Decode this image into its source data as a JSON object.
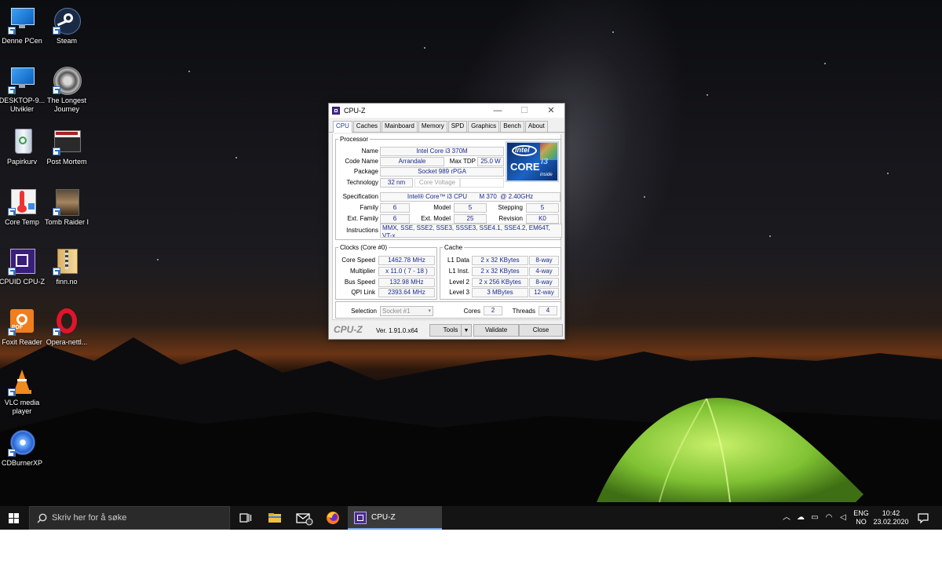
{
  "desktop": {
    "icons": [
      {
        "label": "Denne PCen"
      },
      {
        "label": "Steam"
      },
      {
        "label": "DESKTOP-9... Utvikler"
      },
      {
        "label": "The Longest Journey"
      },
      {
        "label": "Papirkurv"
      },
      {
        "label": "Post Mortem"
      },
      {
        "label": "Core Temp"
      },
      {
        "label": "Tomb Raider I"
      },
      {
        "label": "CPUID CPU-Z"
      },
      {
        "label": "finn.no"
      },
      {
        "label": "Foxit Reader"
      },
      {
        "label": "Opera-nettl..."
      },
      {
        "label": "VLC media player"
      },
      {
        "label": "CDBurnerXP"
      }
    ]
  },
  "cpuz": {
    "title": "CPU-Z",
    "window_buttons": {
      "minimize": "—",
      "maximize": "☐",
      "close": "✕"
    },
    "tabs": [
      "CPU",
      "Caches",
      "Mainboard",
      "Memory",
      "SPD",
      "Graphics",
      "Bench",
      "About"
    ],
    "processor": {
      "group": "Processor",
      "name_label": "Name",
      "name": "Intel Core i3 370M",
      "codename_label": "Code Name",
      "codename": "Arrandale",
      "maxtdp_label": "Max TDP",
      "maxtdp": "25.0 W",
      "package_label": "Package",
      "package": "Socket 989 rPGA",
      "technology_label": "Technology",
      "technology": "32 nm",
      "corevoltage_label": "Core Voltage",
      "logo": {
        "brand": "intel",
        "line": "CORE",
        "model": "i3",
        "tag": "inside"
      },
      "spec_label": "Specification",
      "spec": "Intel® Core™ i3 CPU       M 370  @ 2.40GHz",
      "family_label": "Family",
      "family": "6",
      "model_label": "Model",
      "model": "5",
      "stepping_label": "Stepping",
      "stepping": "5",
      "extfamily_label": "Ext. Family",
      "extfamily": "6",
      "extmodel_label": "Ext. Model",
      "extmodel": "25",
      "revision_label": "Revision",
      "revision": "K0",
      "instructions_label": "Instructions",
      "instructions": "MMX, SSE, SSE2, SSE3, SSSE3, SSE4.1, SSE4.2, EM64T, VT-x"
    },
    "clocks": {
      "group": "Clocks (Core #0)",
      "corespeed_label": "Core Speed",
      "corespeed": "1462.78 MHz",
      "multiplier_label": "Multiplier",
      "multiplier": "x 11.0 ( 7 - 18 )",
      "busspeed_label": "Bus Speed",
      "busspeed": "132.98 MHz",
      "qpi_label": "QPI Link",
      "qpi": "2393.64 MHz"
    },
    "cache": {
      "group": "Cache",
      "l1d_label": "L1 Data",
      "l1d": "2 x 32 KBytes",
      "l1d_way": "8-way",
      "l1i_label": "L1 Inst.",
      "l1i": "2 x 32 KBytes",
      "l1i_way": "4-way",
      "l2_label": "Level 2",
      "l2": "2 x 256 KBytes",
      "l2_way": "8-way",
      "l3_label": "Level 3",
      "l3": "3 MBytes",
      "l3_way": "12-way"
    },
    "selection": {
      "label": "Selection",
      "value": "Socket #1",
      "cores_label": "Cores",
      "cores": "2",
      "threads_label": "Threads",
      "threads": "4"
    },
    "footer": {
      "brand": "CPU-Z",
      "version": "Ver. 1.91.0.x64",
      "tools": "Tools",
      "validate": "Validate",
      "close": "Close"
    }
  },
  "taskbar": {
    "search_placeholder": "Skriv her for å søke",
    "active_app": "CPU-Z",
    "lang_top": "ENG",
    "lang_bottom": "NO",
    "time": "10:42",
    "date": "23.02.2020"
  },
  "colors": {
    "value_text": "#1a2a8e",
    "taskbar": "#141414",
    "active_tab_text": "#1f3aa0"
  }
}
